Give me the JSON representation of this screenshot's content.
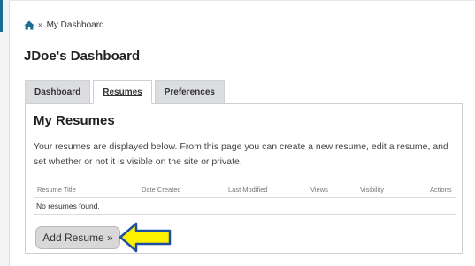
{
  "breadcrumb": {
    "separator": "»",
    "current": "My Dashboard"
  },
  "page": {
    "title": "JDoe's Dashboard"
  },
  "tabs": [
    {
      "label": "Dashboard",
      "active": false
    },
    {
      "label": "Resumes",
      "active": true
    },
    {
      "label": "Preferences",
      "active": false
    }
  ],
  "resumes": {
    "title": "My Resumes",
    "intro": "Your resumes are displayed below. From this page you can create a new resume, edit a resume, and set whether or not it is visible on the site or private.",
    "columns": [
      "Resume Title",
      "Date Created",
      "Last Modified",
      "Views",
      "Visibility",
      "Actions"
    ],
    "empty_message": "No resumes found.",
    "add_button": "Add Resume »"
  },
  "colors": {
    "icon": "#1d6b8d",
    "arrow_fill": "#fff200",
    "arrow_stroke": "#1f4fa0"
  },
  "icons": {
    "home": "home-icon",
    "pointer": "arrow-left-icon"
  }
}
